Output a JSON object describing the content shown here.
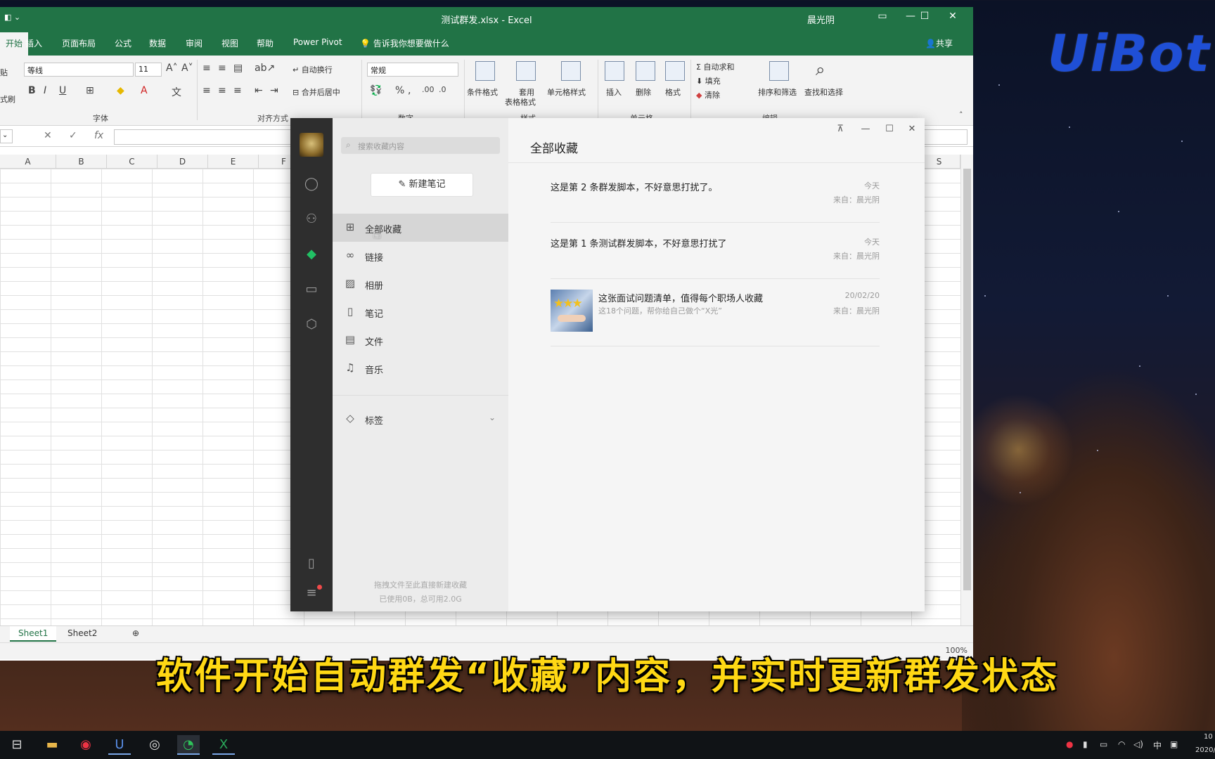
{
  "excel": {
    "title": "测试群发.xlsx  -  Excel",
    "user": "晨光阴",
    "share": "共享",
    "tell_me": "告诉我你想要做什么",
    "tabs": [
      "开始",
      "插入",
      "页面布局",
      "公式",
      "数据",
      "审阅",
      "视图",
      "帮助",
      "Power Pivot"
    ],
    "ribbon": {
      "font_name": "等线",
      "font_size": "11",
      "number_format": "常规",
      "wrap_text": "自动换行",
      "merge_center": "合并后居中",
      "cond_format": "条件格式",
      "table_format_1": "套用",
      "table_format_2": "表格格式",
      "cell_style": "单元格样式",
      "insert": "插入",
      "delete": "删除",
      "format": "格式",
      "autosum": "自动求和",
      "fill": "填充",
      "clear": "清除",
      "sort_filter": "排序和筛选",
      "find_select": "查找和选择",
      "groups": [
        "字体",
        "对齐方式",
        "数字",
        "样式",
        "单元格",
        "编辑"
      ],
      "left_cut_1": "贴",
      "left_cut_2": "式刷"
    },
    "columns": [
      "A",
      "B",
      "C",
      "D",
      "E",
      "F",
      "S"
    ],
    "sheets": [
      "Sheet1",
      "Sheet2"
    ],
    "zoom": "100%"
  },
  "favorites": {
    "search_placeholder": "搜索收藏内容",
    "new_note": "新建笔记",
    "title": "全部收藏",
    "nav": [
      {
        "label": "全部收藏",
        "icon": "grid-icon"
      },
      {
        "label": "链接",
        "icon": "link-icon"
      },
      {
        "label": "相册",
        "icon": "image-icon"
      },
      {
        "label": "笔记",
        "icon": "note-icon"
      },
      {
        "label": "文件",
        "icon": "file-icon"
      },
      {
        "label": "音乐",
        "icon": "music-icon"
      }
    ],
    "tags": "标签",
    "footer_1": "拖拽文件至此直接新建收藏",
    "footer_2": "已使用0B，总可用2.0G",
    "items": [
      {
        "title": "这是第 2 条群发脚本，不好意思打扰了。",
        "date": "今天",
        "source": "来自：晨光阴"
      },
      {
        "title": "这是第 1 条测试群发脚本，不好意思打扰了",
        "date": "今天",
        "source": "来自：晨光阴"
      },
      {
        "title": "这张面试问题清单，值得每个职场人收藏",
        "subtitle": "这18个问题，帮你给自己做个“X光”",
        "date": "20/02/20",
        "source": "来自：晨光阴"
      }
    ]
  },
  "brand": "UiBot",
  "subtitle": "软件开始自动群发“收藏”内容，并实时更新群发状态",
  "taskbar": {
    "lang": "中",
    "clock_1": "10",
    "clock_2": "2020/"
  }
}
